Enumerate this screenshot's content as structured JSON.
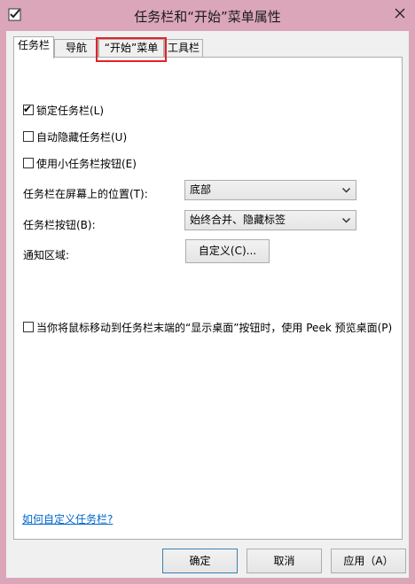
{
  "window": {
    "title": "任务栏和“开始”菜单属性",
    "frame_color": "#dba6b9"
  },
  "tabs": [
    {
      "label": "任务栏",
      "active": true
    },
    {
      "label": "导航",
      "active": false
    },
    {
      "label": "“开始”菜单",
      "active": false,
      "highlighted": true
    },
    {
      "label": "工具栏",
      "active": false
    }
  ],
  "highlight_color": "#e52125",
  "checkboxes": {
    "lock": {
      "label": "锁定任务栏(L)",
      "checked": true
    },
    "autohide": {
      "label": "自动隐藏任务栏(U)",
      "checked": false
    },
    "small_buttons": {
      "label": "使用小任务栏按钮(E)",
      "checked": false
    },
    "peek": {
      "label": "当你将鼠标移动到任务栏末端的“显示桌面”按钮时，使用 Peek 预览桌面(P)",
      "checked": false
    }
  },
  "position": {
    "label": "任务栏在屏幕上的位置(T):",
    "value": "底部"
  },
  "buttons_setting": {
    "label": "任务栏按钮(B):",
    "value": "始终合并、隐藏标签"
  },
  "notify": {
    "label": "通知区域:",
    "button_label": "自定义(C)..."
  },
  "help_link": "如何自定义任务栏?",
  "footer": {
    "ok": "确定",
    "cancel": "取消",
    "apply": "应用（A）"
  },
  "icons": {
    "app": "checkbox-app-icon",
    "close": "close-icon",
    "dropdown": "chevron-down-icon"
  }
}
